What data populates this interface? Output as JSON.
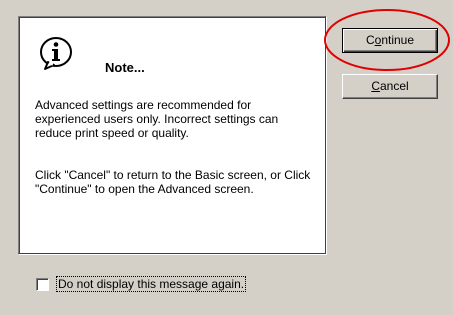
{
  "dialog": {
    "title": "Note...",
    "icon": "info-icon",
    "paragraph1": "Advanced settings are recommended for experienced users only. Incorrect settings can reduce print speed or quality.",
    "paragraph2": "Click \"Cancel\" to return to the Basic screen, or Click \"Continue\" to open the Advanced screen."
  },
  "buttons": {
    "continue_label": "Continue",
    "continue_mnemonic": "o",
    "cancel_label": "Cancel",
    "cancel_mnemonic": "C"
  },
  "checkbox": {
    "label": "Do not display this message again.",
    "checked": false
  },
  "colors": {
    "dialog_background": "#d4d0c8",
    "panel_background": "#ffffff",
    "highlight_ellipse": "#e00000"
  }
}
